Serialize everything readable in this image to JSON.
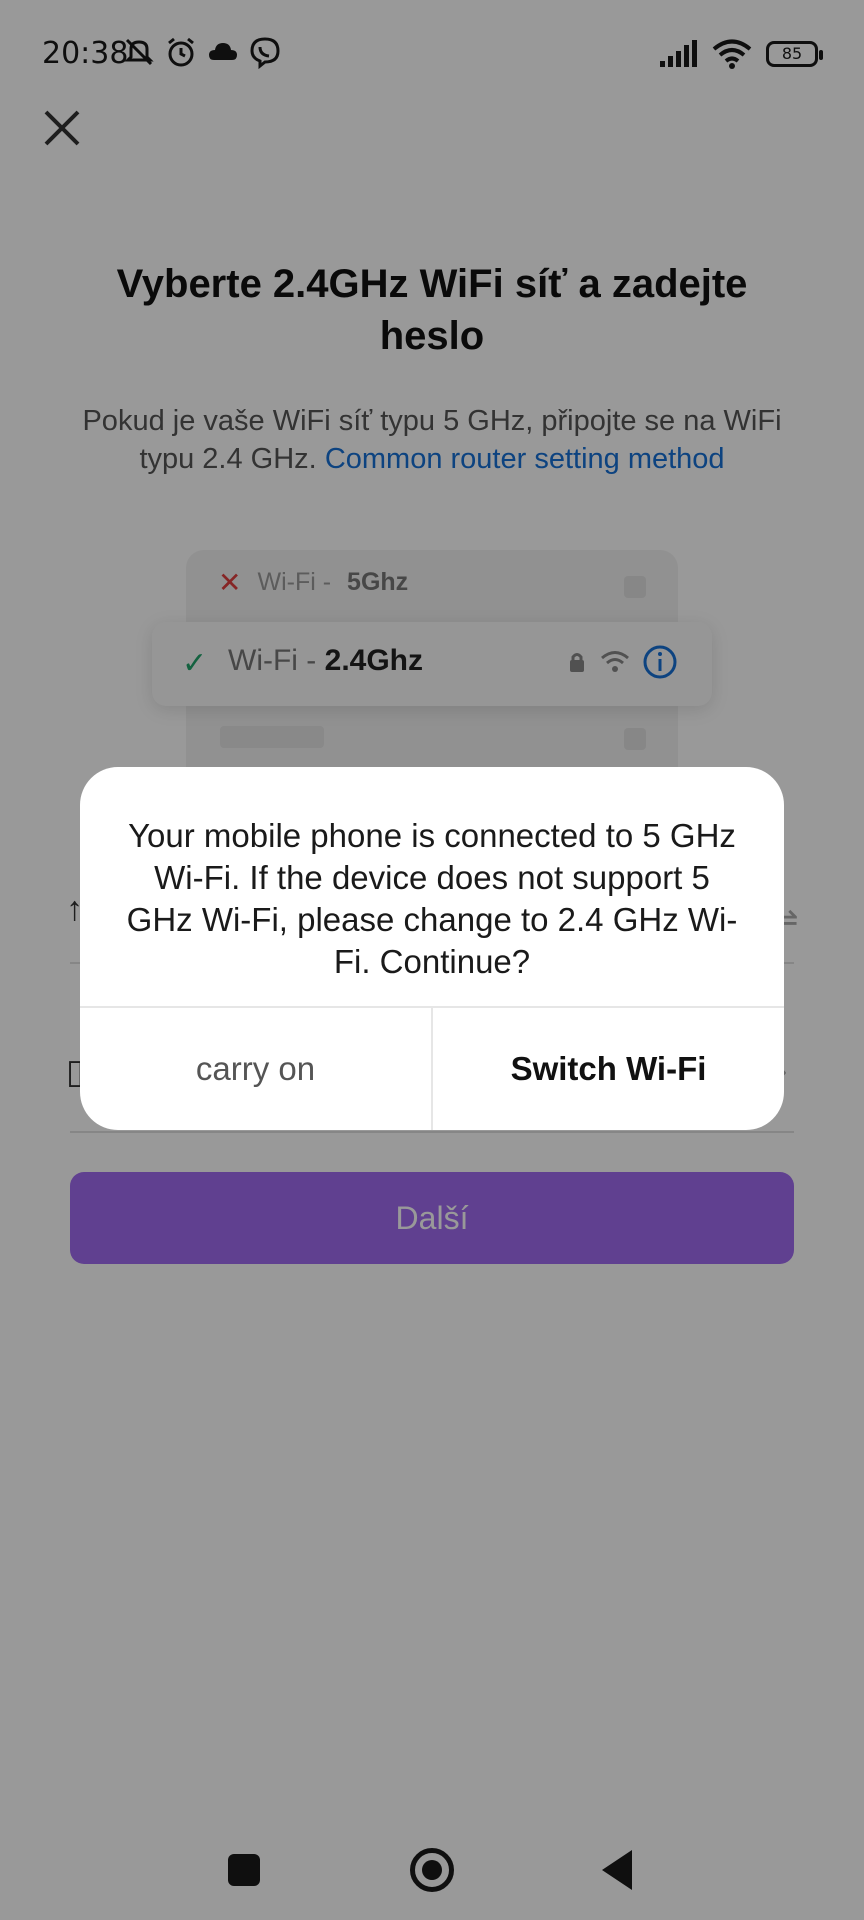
{
  "status_bar": {
    "time": "20:38",
    "battery": "85",
    "left_icons": [
      "mute-icon",
      "alarm-icon",
      "cloud-icon",
      "viber-icon"
    ],
    "right_icons": [
      "signal-icon",
      "wifi-icon",
      "battery-icon"
    ]
  },
  "page": {
    "title": "Vyberte 2.4GHz WiFi síť a zadejte heslo",
    "subtitle": "Pokud je vaše WiFi síť typu 5 GHz, připojte se na WiFi typu 2.4 GHz.",
    "subtitle_link": "Common router setting method"
  },
  "illustration": {
    "row_bad_prefix": "Wi-Fi -",
    "row_bad_band": "5Ghz",
    "row_good_prefix": "Wi-Fi -",
    "row_good_band": "2.4Ghz"
  },
  "next_button": {
    "label": "Další"
  },
  "dialog": {
    "message": "Your mobile phone is connected to 5 GHz Wi-Fi. If the device does not support 5 GHz Wi-Fi, please change to 2.4 GHz Wi-Fi. Continue?",
    "cancel_label": "carry on",
    "confirm_label": "Switch Wi-Fi"
  },
  "colors": {
    "accent": "#a06cf0",
    "link": "#1670d6",
    "success": "#22a36b",
    "error": "#e04040"
  }
}
